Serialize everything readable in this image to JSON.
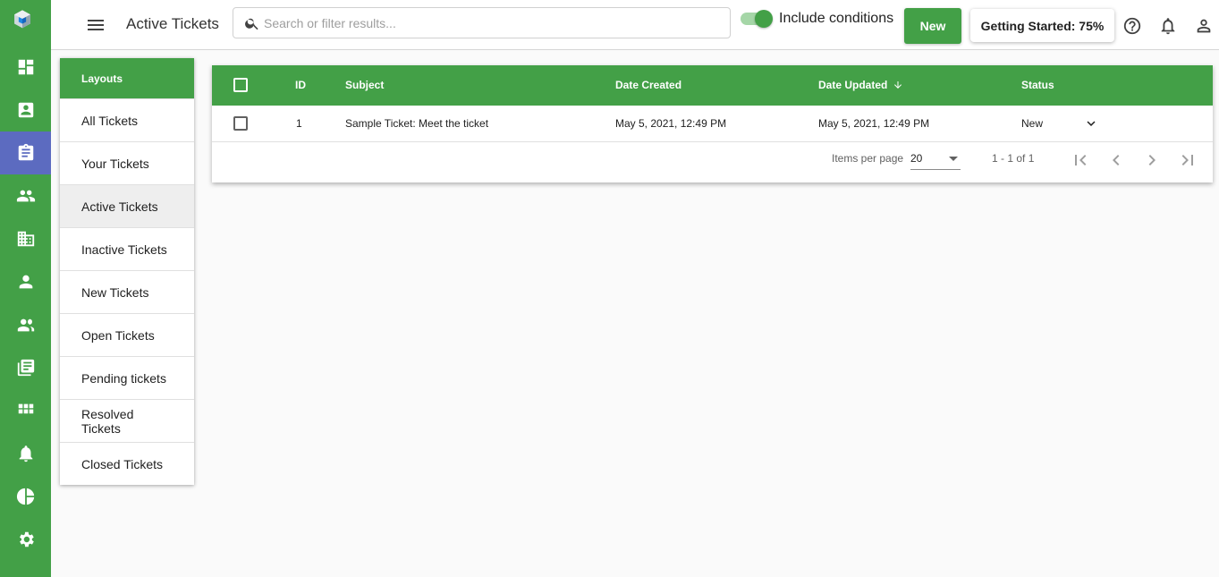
{
  "header": {
    "title": "Active Tickets",
    "search_placeholder": "Search or filter results...",
    "toggle_label": "Include conditions",
    "toggle_on": true,
    "new_button": "New",
    "getting_started": "Getting Started: 75%"
  },
  "sidebar_icons": [
    "app-logo-icon",
    "dashboard-icon",
    "contacts-icon",
    "tickets-icon",
    "groups-icon",
    "organizations-icon",
    "person-icon",
    "team-icon",
    "knowledge-base-icon",
    "apps-icon",
    "notifications-icon",
    "reports-icon",
    "settings-icon"
  ],
  "layouts": {
    "header": "Layouts",
    "items": [
      {
        "label": "All Tickets"
      },
      {
        "label": "Your Tickets"
      },
      {
        "label": "Active Tickets"
      },
      {
        "label": "Inactive Tickets"
      },
      {
        "label": "New Tickets"
      },
      {
        "label": "Open Tickets"
      },
      {
        "label": "Pending tickets"
      },
      {
        "label": "Resolved Tickets"
      },
      {
        "label": "Closed Tickets"
      }
    ],
    "active": "Active Tickets"
  },
  "table": {
    "columns": [
      "ID",
      "Subject",
      "Date Created",
      "Date Updated",
      "Status"
    ],
    "sorted_column": "Date Updated",
    "sort_direction": "descending",
    "rows": [
      {
        "id": "1",
        "subject": "Sample Ticket: Meet the ticket",
        "date_created": "May 5, 2021, 12:49 PM",
        "date_updated": "May 5, 2021, 12:49 PM",
        "status": "New"
      }
    ]
  },
  "pagination": {
    "items_per_page_label": "Items per page",
    "items_per_page": "20",
    "range": "1 - 1 of 1"
  },
  "colors": {
    "primary_green": "#43a047",
    "active_rail": "#5c6bc0"
  }
}
